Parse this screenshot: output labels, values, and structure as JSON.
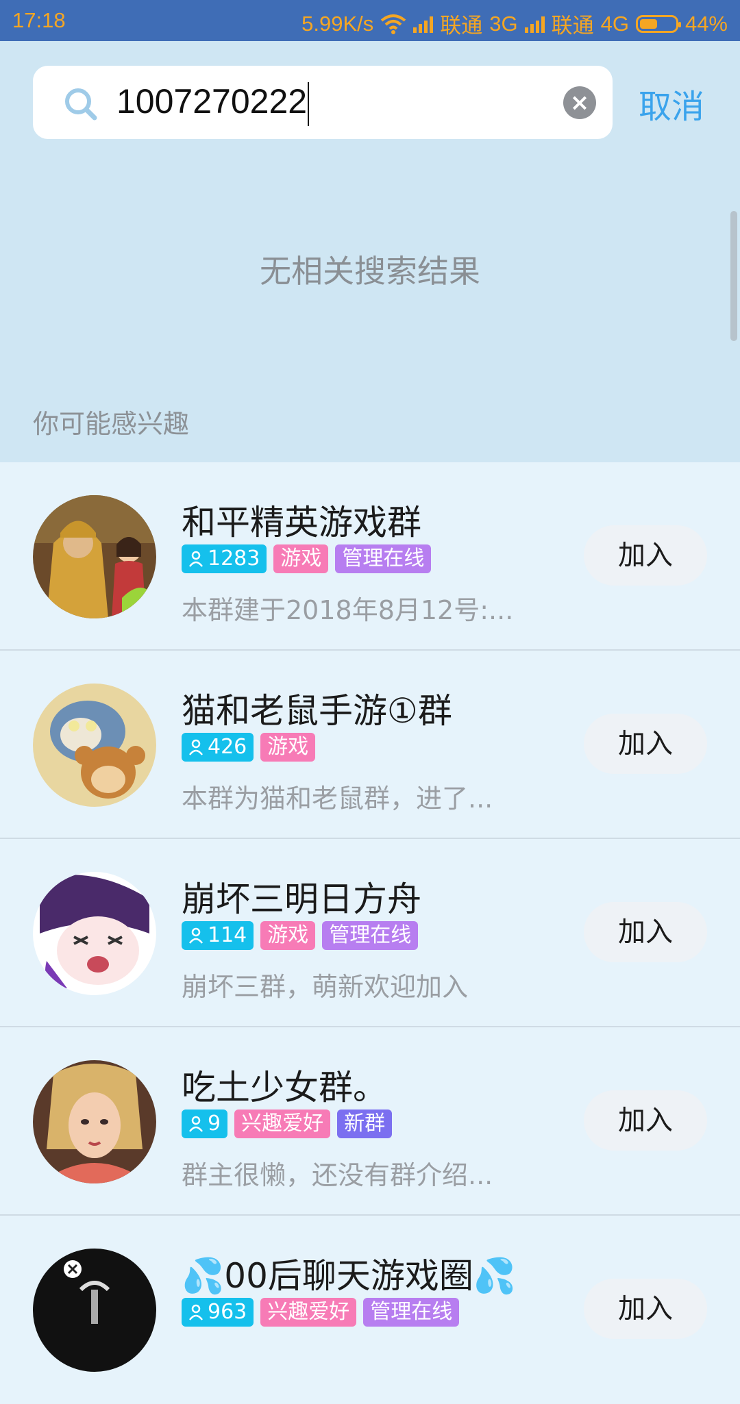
{
  "status_bar": {
    "time": "17:18",
    "net_speed": "5.99K/s",
    "carrier1": "联通",
    "net1": "3G",
    "carrier2": "联通",
    "net2": "4G",
    "battery": "44%",
    "color": "#f5a623",
    "bg": "#3f6db6"
  },
  "search": {
    "value": "1007270222",
    "cancel_label": "取消"
  },
  "no_result_text": "无相关搜索结果",
  "suggest_title": "你可能感兴趣",
  "accent": "#3aa3ec",
  "groups": [
    {
      "name": "和平精英游戏群",
      "count": "1283",
      "tags": [
        "游戏",
        "管理在线"
      ],
      "desc": "本群建于2018年8月12号:...",
      "join_label": "加入"
    },
    {
      "name": "猫和老鼠手游①群",
      "count": "426",
      "tags": [
        "游戏"
      ],
      "desc": "本群为猫和老鼠群，进了...",
      "join_label": "加入"
    },
    {
      "name": "崩坏三明日方舟",
      "count": "114",
      "tags": [
        "游戏",
        "管理在线"
      ],
      "desc": "崩坏三群，萌新欢迎加入",
      "join_label": "加入"
    },
    {
      "name": "吃土少女群。",
      "count": "9",
      "tags": [
        "兴趣爱好",
        "新群"
      ],
      "desc": "群主很懒，还没有群介绍...",
      "join_label": "加入"
    },
    {
      "name": "💦00后聊天游戏圈💦",
      "count": "963",
      "tags": [
        "兴趣爱好",
        "管理在线"
      ],
      "desc": "",
      "join_label": "加入"
    }
  ]
}
